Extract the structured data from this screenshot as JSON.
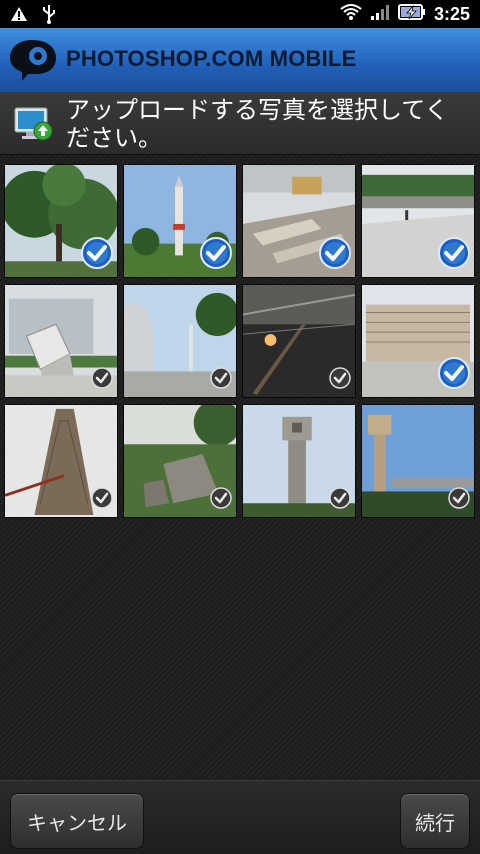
{
  "status_bar": {
    "time": "3:25",
    "icons": [
      "warning-icon",
      "usb-icon",
      "wifi-icon",
      "signal-icon",
      "battery-charging-icon"
    ]
  },
  "app": {
    "title": "PHOTOSHOP.COM MOBILE",
    "logo": "photoshop-logo",
    "accent": "#2f7ad0"
  },
  "prompt": {
    "text": "アップロードする写真を選択してください。",
    "icon": "upload-monitor-icon"
  },
  "photos": [
    {
      "scene": "trees",
      "selected": true
    },
    {
      "scene": "rocket",
      "selected": true
    },
    {
      "scene": "ruins",
      "selected": true
    },
    {
      "scene": "plaza",
      "selected": true
    },
    {
      "scene": "cube-sculpture",
      "selected": false
    },
    {
      "scene": "museum",
      "selected": false
    },
    {
      "scene": "stairs",
      "selected": false
    },
    {
      "scene": "building",
      "selected": true
    },
    {
      "scene": "tower-facade",
      "selected": false
    },
    {
      "scene": "garden-rocks",
      "selected": false
    },
    {
      "scene": "concrete-tower",
      "selected": false
    },
    {
      "scene": "cross-tower",
      "selected": false
    }
  ],
  "buttons": {
    "cancel": "キャンセル",
    "continue": "続行"
  }
}
